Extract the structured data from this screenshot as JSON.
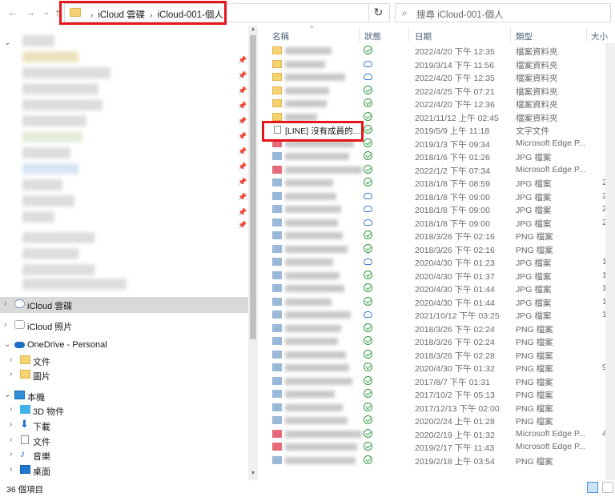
{
  "nav": {
    "back": "←",
    "forward": "→",
    "recent": "⌄",
    "up": "↑"
  },
  "address": {
    "crumbs": [
      "iCloud 雲碟",
      "iCloud-001-個人"
    ],
    "dropdown": "⌄",
    "refresh": "↻"
  },
  "search": {
    "icon": "⌕",
    "placeholder": "搜尋 iCloud-001-個人"
  },
  "sidebar": {
    "items": [
      {
        "label": "iCloud 雲碟",
        "icon": "icloud-drive-icon",
        "selected": true
      },
      {
        "label": "iCloud 照片",
        "icon": "icloud-photos-icon"
      },
      {
        "label": "OneDrive - Personal",
        "icon": "onedrive-icon"
      },
      {
        "label": "文件",
        "icon": "folder-icon"
      },
      {
        "label": "圖片",
        "icon": "folder-icon"
      },
      {
        "label": "本機",
        "icon": "this-pc-icon"
      },
      {
        "label": "3D 物件",
        "icon": "3d-objects-icon"
      },
      {
        "label": "下載",
        "icon": "downloads-icon"
      },
      {
        "label": "文件",
        "icon": "documents-icon"
      },
      {
        "label": "音樂",
        "icon": "music-icon"
      },
      {
        "label": "桌面",
        "icon": "desktop-icon"
      }
    ],
    "chevrons": {
      "collapsed": "›",
      "expanded": "⌄"
    },
    "pin": "📌"
  },
  "list": {
    "columns": {
      "name": "名稱",
      "status": "狀態",
      "date": "日期",
      "type": "類型",
      "size": "大小"
    },
    "sort_arrow": "^",
    "rows": [
      {
        "kind": "folder",
        "status": "ok",
        "date": "2022/4/20 下午 12:35",
        "type": "檔案資料夾"
      },
      {
        "kind": "folder",
        "status": "cloud",
        "date": "2019/3/14 下午 11:56",
        "type": "檔案資料夾"
      },
      {
        "kind": "folder",
        "status": "cloud",
        "date": "2022/4/20 下午 12:35",
        "type": "檔案資料夾"
      },
      {
        "kind": "folder",
        "status": "ok",
        "date": "2022/4/25 下午 07:21",
        "type": "檔案資料夾"
      },
      {
        "kind": "folder",
        "status": "ok",
        "date": "2022/4/20 下午 12:36",
        "type": "檔案資料夾"
      },
      {
        "kind": "folder",
        "status": "ok",
        "date": "2021/11/12 上午 02:45",
        "type": "檔案資料夾"
      },
      {
        "kind": "txt",
        "name": "[LINE] 沒有成員的...",
        "status": "ok",
        "date": "2019/5/9 上午 11:18",
        "type": "文字文件"
      },
      {
        "kind": "edge",
        "status": "ok",
        "date": "2019/1/3 下午 09:34",
        "type": "Microsoft Edge P..."
      },
      {
        "kind": "img",
        "status": "ok",
        "date": "2018/1/6 下午 01:26",
        "type": "JPG 檔案"
      },
      {
        "kind": "edge",
        "status": "ok",
        "date": "2022/1/2 下午 07:34",
        "type": "Microsoft Edge P..."
      },
      {
        "kind": "img",
        "status": "ok",
        "date": "2018/1/8 下午 08:59",
        "type": "JPG 檔案",
        "size": "2"
      },
      {
        "kind": "img",
        "status": "cloud",
        "date": "2018/1/8 下午 09:00",
        "type": "JPG 檔案",
        "size": "2"
      },
      {
        "kind": "img",
        "status": "cloud",
        "date": "2018/1/8 下午 09:00",
        "type": "JPG 檔案",
        "size": "2"
      },
      {
        "kind": "img",
        "status": "cloud",
        "date": "2018/1/8 下午 09:00",
        "type": "JPG 檔案",
        "size": "2"
      },
      {
        "kind": "img",
        "status": "ok",
        "date": "2018/3/26 下午 02:16",
        "type": "PNG 檔案"
      },
      {
        "kind": "img",
        "status": "ok",
        "date": "2018/3/26 下午 02:16",
        "type": "PNG 檔案"
      },
      {
        "kind": "img",
        "status": "cloud",
        "date": "2020/4/30 下午 01:23",
        "type": "JPG 檔案",
        "size": "1"
      },
      {
        "kind": "img",
        "status": "ok",
        "date": "2020/4/30 下午 01:37",
        "type": "JPG 檔案",
        "size": "1"
      },
      {
        "kind": "img",
        "status": "ok",
        "date": "2020/4/30 下午 01:44",
        "type": "JPG 檔案",
        "size": "1"
      },
      {
        "kind": "img",
        "status": "ok",
        "date": "2020/4/30 下午 01:44",
        "type": "JPG 檔案",
        "size": "1"
      },
      {
        "kind": "img",
        "status": "cloud",
        "date": "2021/10/12 下午 03:25",
        "type": "JPG 檔案",
        "size": "1"
      },
      {
        "kind": "img",
        "status": "ok",
        "date": "2018/3/26 下午 02:24",
        "type": "PNG 檔案"
      },
      {
        "kind": "img",
        "status": "ok",
        "date": "2018/3/26 下午 02:24",
        "type": "PNG 檔案"
      },
      {
        "kind": "img",
        "status": "ok",
        "date": "2018/3/26 下午 02:28",
        "type": "PNG 檔案"
      },
      {
        "kind": "img",
        "status": "ok",
        "date": "2020/4/30 下午 01:32",
        "type": "PNG 檔案",
        "size": "9"
      },
      {
        "kind": "img",
        "status": "ok",
        "date": "2017/8/7 下午 01:31",
        "type": "PNG 檔案"
      },
      {
        "kind": "img",
        "status": "ok",
        "date": "2017/10/2 下午 05:13",
        "type": "PNG 檔案"
      },
      {
        "kind": "img",
        "status": "ok",
        "date": "2017/12/13 下午 02:00",
        "type": "PNG 檔案"
      },
      {
        "kind": "img",
        "status": "ok",
        "date": "2020/2/24 上午 01:28",
        "type": "PNG 檔案"
      },
      {
        "kind": "edge",
        "status": "ok",
        "date": "2020/2/19 上午 01:32",
        "type": "Microsoft Edge P...",
        "size": "4"
      },
      {
        "kind": "edge",
        "status": "ok",
        "date": "2019/2/17 下午 11:43",
        "type": "Microsoft Edge P..."
      },
      {
        "kind": "img",
        "status": "ok",
        "date": "2019/2/18 上午 03:54",
        "type": "PNG 檔案"
      }
    ]
  },
  "statusbar": {
    "count": "36 個項目"
  }
}
